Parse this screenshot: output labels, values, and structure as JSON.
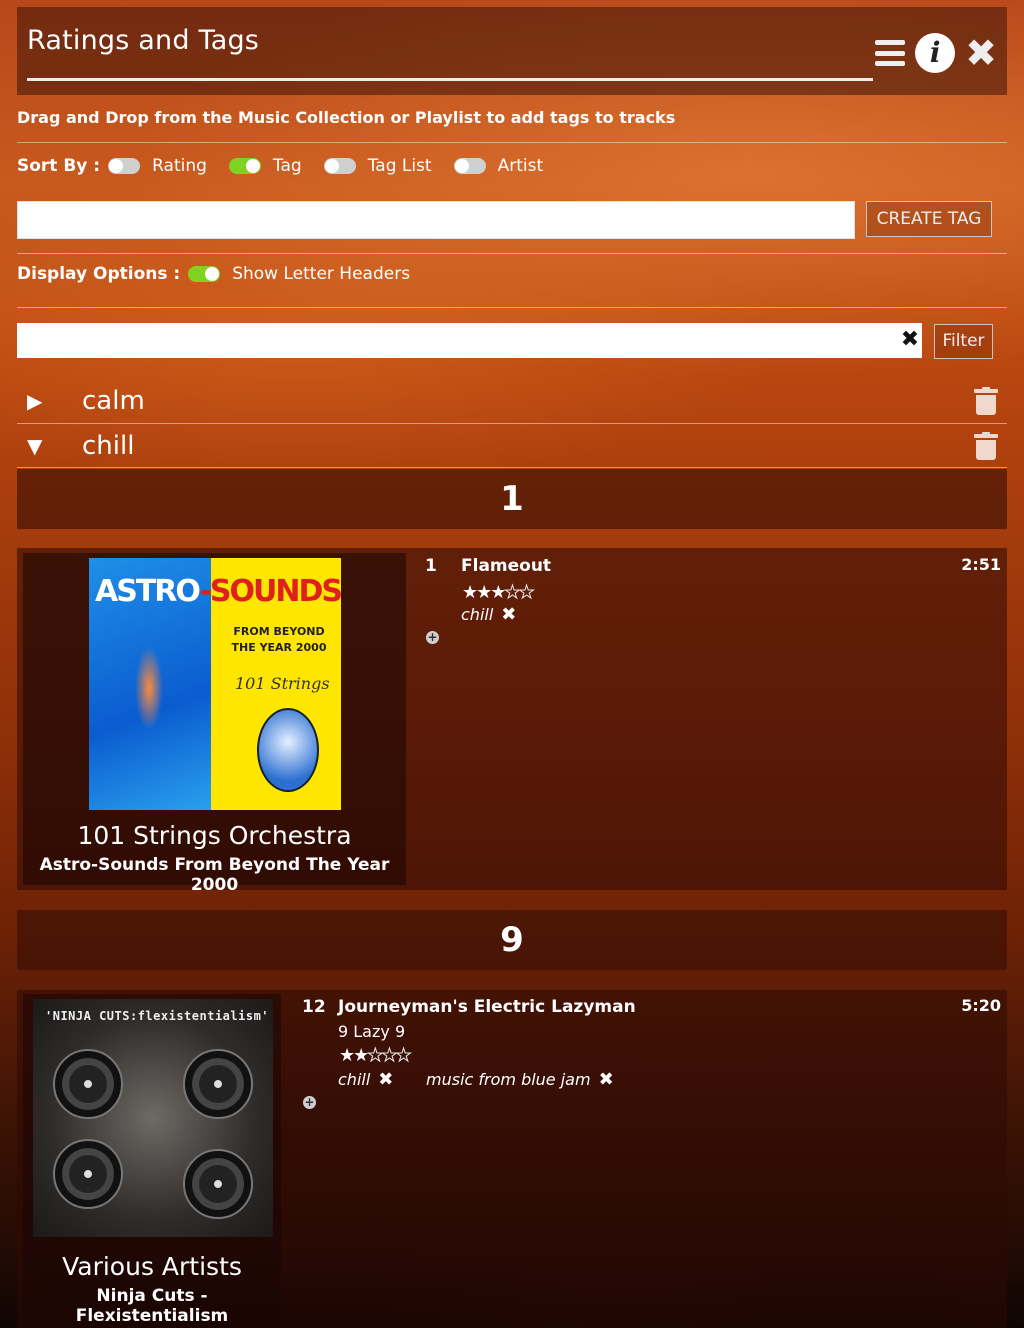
{
  "header": {
    "title": "Ratings and Tags"
  },
  "instructions": "Drag and Drop from the Music Collection or Playlist to add tags to tracks",
  "sort": {
    "label": "Sort By :",
    "options": [
      {
        "label": "Rating",
        "on": false
      },
      {
        "label": "Tag",
        "on": true
      },
      {
        "label": "Tag List",
        "on": false
      },
      {
        "label": "Artist",
        "on": false
      }
    ]
  },
  "create_tag": {
    "input_value": "",
    "button_label": "CREATE TAG"
  },
  "display_options": {
    "label": "Display Options :",
    "show_letter_headers_label": "Show Letter Headers",
    "show_letter_headers_on": true
  },
  "filter": {
    "input_value": "",
    "button_label": "Filter"
  },
  "tags": [
    {
      "name": "calm",
      "expanded": false
    },
    {
      "name": "chill",
      "expanded": true
    }
  ],
  "groups": [
    {
      "letter": "1",
      "album": {
        "artist": "101 Strings Orchestra",
        "title": "Astro-Sounds From Beyond The Year 2000",
        "cover_text": {
          "title_a": "ASTRO",
          "title_b": "-SOUNDS",
          "sub": "FROM BEYOND THE YEAR 2000",
          "script": "101 Strings"
        },
        "tracks": [
          {
            "number": "1",
            "title": "Flameout",
            "artist": "",
            "duration": "2:51",
            "rating": 3,
            "tags": [
              "chill"
            ]
          }
        ]
      }
    },
    {
      "letter": "9",
      "album": {
        "artist": "Various Artists",
        "title": "Ninja Cuts - Flexistentialism",
        "cover_text": {
          "title": "'NINJA CUTS:flexistentialism'"
        },
        "tracks": [
          {
            "number": "12",
            "title": "Journeyman's Electric Lazyman",
            "artist": "9 Lazy 9",
            "duration": "5:20",
            "rating": 2,
            "tags": [
              "chill",
              "music from blue jam"
            ]
          }
        ]
      }
    }
  ],
  "icons": {
    "menu": "hamburger-icon",
    "info": "info-icon",
    "close": "close-icon",
    "trash": "trash-icon",
    "add": "plus-circle-icon",
    "remove_tag": "x-icon",
    "expand": "triangle-right-icon",
    "collapse": "triangle-down-icon"
  },
  "colors": {
    "toggle_on": "#7ed321",
    "toggle_off": "#cfcfcf"
  }
}
